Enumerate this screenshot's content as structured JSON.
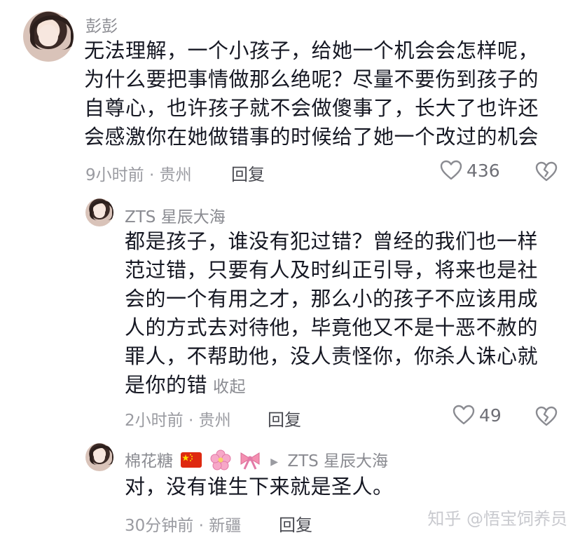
{
  "comments": [
    {
      "username": "彭彭",
      "lines": [
        "无法理解，一个小孩子，给她一个机会会怎样呢，",
        "为什么要把事情做那么绝呢？尽量不要伤到孩子的",
        "自尊心，也许孩子就不会做傻事了，长大了也许还",
        "会感激你在她做错事的时候给了她一个改过的机会"
      ],
      "meta": "9小时前 · 贵州",
      "reply_label": "回复",
      "like_count": "436"
    },
    {
      "username": "ZTS 星辰大海",
      "lines": [
        "都是孩子，谁没有犯过错？曾经的我们也一样",
        "范过错，只要有人及时纠正引导，将来也是社",
        "会的一个有用之才，那么小的孩子不应该用成",
        "人的方式去对待他，毕竟他又不是十恶不赦的",
        "罪人，不帮助他，没人责怪你，你杀人诛心就",
        "是你的错"
      ],
      "collapse_label": "收起",
      "meta": "2小时前 · 贵州",
      "reply_label": "回复",
      "like_count": "49"
    },
    {
      "username": "棉花糖",
      "reply_to": "ZTS 星辰大海",
      "lines": [
        "对，没有谁生下来就是圣人。"
      ],
      "meta": "30分钟前 · 新疆",
      "reply_label": "回复"
    }
  ],
  "watermark": "知乎 @悟宝饲养员",
  "icons": {
    "like": "heart-outline-icon",
    "dislike": "broken-heart-icon",
    "flag": "china-flag-emoji",
    "flower": "cherry-blossom-emoji",
    "ribbon": "ribbon-emoji",
    "reply_arrow": "triangle-right-icon"
  }
}
